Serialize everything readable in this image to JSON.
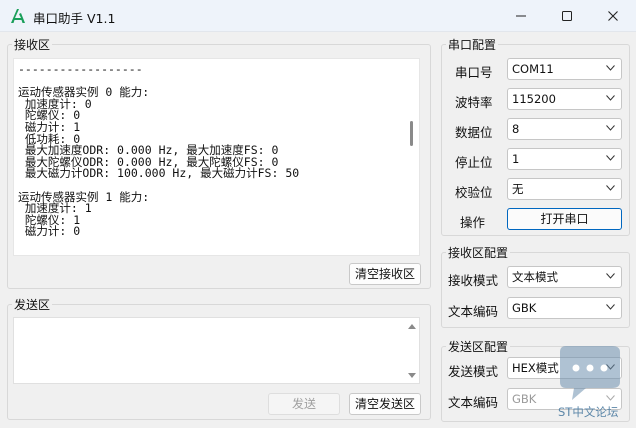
{
  "window": {
    "title": "串口助手 V1.1",
    "controls": {
      "minimize": "minimize-icon",
      "maximize": "maximize-icon",
      "close": "close-icon"
    }
  },
  "receive": {
    "group_title": "接收区",
    "lines": [
      "------------------",
      "",
      "运动传感器实例 0 能力:",
      " 加速度计: 0",
      " 陀螺仪: 0",
      " 磁力计: 1",
      " 低功耗: 0",
      " 最大加速度ODR: 0.000 Hz, 最大加速度FS: 0",
      " 最大陀螺仪ODR: 0.000 Hz, 最大陀螺仪FS: 0",
      " 最大磁力计ODR: 100.000 Hz, 最大磁力计FS: 50",
      "",
      "运动传感器实例 1 能力:",
      " 加速度计: 1",
      " 陀螺仪: 1",
      " 磁力计: 0"
    ],
    "clear_button": "清空接收区"
  },
  "send": {
    "group_title": "发送区",
    "text": "",
    "send_button": "发送",
    "clear_button": "清空发送区"
  },
  "serial_config": {
    "group_title": "串口配置",
    "port_label": "串口号",
    "port_value": "COM11",
    "baud_label": "波特率",
    "baud_value": "115200",
    "databits_label": "数据位",
    "databits_value": "8",
    "stopbits_label": "停止位",
    "stopbits_value": "1",
    "parity_label": "校验位",
    "parity_value": "无",
    "action_label": "操作",
    "open_button": "打开串口"
  },
  "rx_config": {
    "group_title": "接收区配置",
    "mode_label": "接收模式",
    "mode_value": "文本模式",
    "encoding_label": "文本编码",
    "encoding_value": "GBK"
  },
  "tx_config": {
    "group_title": "发送区配置",
    "mode_label": "发送模式",
    "mode_value": "HEX模式",
    "encoding_label": "文本编码",
    "encoding_value": "GBK"
  },
  "watermark": {
    "text": "ST中文论坛",
    "icon": "chat-bubble-icon"
  },
  "colors": {
    "accent": "#0067c0",
    "app_icon": "#1a9f5a",
    "watermark": "#5b86a8"
  }
}
